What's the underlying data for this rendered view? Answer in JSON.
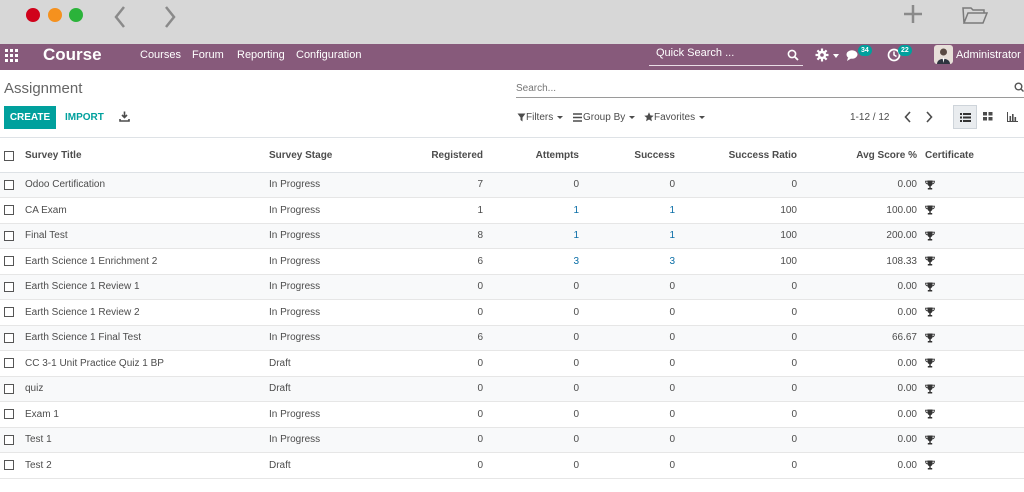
{
  "topbar": {
    "brand": "Course",
    "menus": [
      "Courses",
      "Forum",
      "Reporting",
      "Configuration"
    ],
    "quick_search": "Quick Search ...",
    "chat_count": "34",
    "activity_count": "22",
    "user": "Administrator"
  },
  "control_panel": {
    "breadcrumb": "Assignment",
    "search_placeholder": "Search...",
    "create_label": "CREATE",
    "import_label": "IMPORT",
    "filters_label": "Filters",
    "groupby_label": "Group By",
    "favorites_label": "Favorites",
    "pager": "1-12 / 12"
  },
  "table": {
    "headers": [
      "Survey Title",
      "Survey Stage",
      "Registered",
      "Attempts",
      "Success",
      "Success Ratio",
      "Avg Score %",
      "Certificate"
    ],
    "rows": [
      {
        "title": "Odoo Certification",
        "stage": "In Progress",
        "registered": "7",
        "attempts": "0",
        "success": "0",
        "ratio": "0",
        "avg": "0.00"
      },
      {
        "title": "CA Exam",
        "stage": "In Progress",
        "registered": "1",
        "attempts": "1",
        "success": "1",
        "ratio": "100",
        "avg": "100.00"
      },
      {
        "title": "Final Test",
        "stage": "In Progress",
        "registered": "8",
        "attempts": "1",
        "success": "1",
        "ratio": "100",
        "avg": "200.00"
      },
      {
        "title": "Earth Science 1 Enrichment 2",
        "stage": "In Progress",
        "registered": "6",
        "attempts": "3",
        "success": "3",
        "ratio": "100",
        "avg": "108.33"
      },
      {
        "title": "Earth Science 1 Review 1",
        "stage": "In Progress",
        "registered": "0",
        "attempts": "0",
        "success": "0",
        "ratio": "0",
        "avg": "0.00"
      },
      {
        "title": "Earth Science 1 Review 2",
        "stage": "In Progress",
        "registered": "0",
        "attempts": "0",
        "success": "0",
        "ratio": "0",
        "avg": "0.00"
      },
      {
        "title": "Earth Science 1 Final Test",
        "stage": "In Progress",
        "registered": "6",
        "attempts": "0",
        "success": "0",
        "ratio": "0",
        "avg": "66.67"
      },
      {
        "title": "CC 3-1 Unit Practice Quiz 1 BP",
        "stage": "Draft",
        "registered": "0",
        "attempts": "0",
        "success": "0",
        "ratio": "0",
        "avg": "0.00"
      },
      {
        "title": "quiz",
        "stage": "Draft",
        "registered": "0",
        "attempts": "0",
        "success": "0",
        "ratio": "0",
        "avg": "0.00"
      },
      {
        "title": "Exam 1",
        "stage": "In Progress",
        "registered": "0",
        "attempts": "0",
        "success": "0",
        "ratio": "0",
        "avg": "0.00"
      },
      {
        "title": "Test 1",
        "stage": "In Progress",
        "registered": "0",
        "attempts": "0",
        "success": "0",
        "ratio": "0",
        "avg": "0.00"
      },
      {
        "title": "Test 2",
        "stage": "Draft",
        "registered": "0",
        "attempts": "0",
        "success": "0",
        "ratio": "0",
        "avg": "0.00"
      }
    ]
  },
  "colors": {
    "brand_purple": "#875a7b",
    "accent_teal": "#00a09d",
    "link_blue": "#0a6ea7"
  },
  "icons": [
    "apps-icon",
    "search-icon",
    "gear-icon",
    "chat-icon",
    "clock-icon",
    "download-icon",
    "filter-icon",
    "list-view-icon",
    "kanban-view-icon",
    "graph-view-icon",
    "trophy-icon"
  ]
}
